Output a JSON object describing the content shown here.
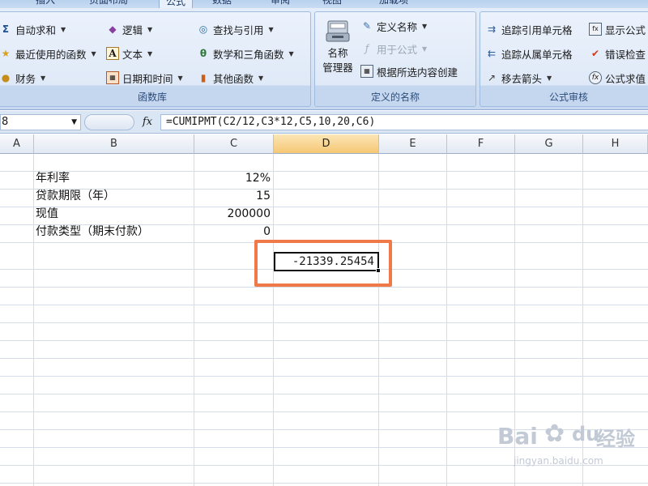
{
  "tabs": [
    "插入",
    "页面布局",
    "公式",
    "数据",
    "审阅",
    "视图",
    "加载项"
  ],
  "active_tab_index": 2,
  "ribbon": {
    "function_library": {
      "label": "函数库",
      "items": [
        {
          "label": "自动求和",
          "icon": "sigma-icon",
          "caret": true
        },
        {
          "label": "最近使用的函数",
          "icon": "star-icon",
          "caret": true
        },
        {
          "label": "财务",
          "icon": "coins-icon",
          "caret": true
        },
        {
          "label": "逻辑",
          "icon": "logic-icon",
          "caret": true
        },
        {
          "label": "文本",
          "icon": "text-icon",
          "caret": true
        },
        {
          "label": "日期和时间",
          "icon": "calendar-icon",
          "caret": true
        },
        {
          "label": "查找与引用",
          "icon": "lookup-icon",
          "caret": true
        },
        {
          "label": "数学和三角函数",
          "icon": "math-icon",
          "caret": true
        },
        {
          "label": "其他函数",
          "icon": "more-functions-icon",
          "caret": true
        }
      ]
    },
    "defined_names": {
      "label": "定义的名称",
      "name_manager": "名称\n管理器",
      "items": [
        {
          "label": "定义名称",
          "icon": "define-name-icon",
          "caret": true,
          "disabled": false
        },
        {
          "label": "用于公式",
          "icon": "use-in-formula-icon",
          "caret": true,
          "disabled": true
        },
        {
          "label": "根据所选内容创建",
          "icon": "create-from-selection-icon",
          "caret": false,
          "disabled": false
        }
      ]
    },
    "formula_auditing": {
      "label": "公式审核",
      "items": [
        {
          "label": "追踪引用单元格",
          "icon": "trace-precedents-icon"
        },
        {
          "label": "追踪从属单元格",
          "icon": "trace-dependents-icon"
        },
        {
          "label": "移去箭头",
          "icon": "remove-arrows-icon",
          "caret": true
        },
        {
          "label": "显示公式",
          "icon": "show-formulas-icon"
        },
        {
          "label": "错误检查",
          "icon": "error-checking-icon",
          "caret": true
        },
        {
          "label": "公式求值",
          "icon": "evaluate-formula-icon"
        }
      ]
    }
  },
  "formula_bar": {
    "name_box": "8",
    "fx_label": "fx",
    "formula": "=CUMIPMT(C2/12,C3*12,C5,10,20,C6)"
  },
  "columns": [
    "A",
    "B",
    "C",
    "D",
    "E",
    "F",
    "G",
    "H"
  ],
  "selected_column": "D",
  "rows": [
    {
      "label": "年利率",
      "value": "12%"
    },
    {
      "label": "贷款期限（年）",
      "value": "15"
    },
    {
      "label": "现值",
      "value": "200000"
    },
    {
      "label": "付款类型（期末付款）",
      "value": "0"
    }
  ],
  "result_cell": "-21339.25454",
  "colors": {
    "highlight_box": "#f0794a",
    "selected_header": "#f6c774",
    "ribbon_bg": "#dfe9f7"
  },
  "watermark": {
    "brand": "Bai",
    "brand2": "du",
    "brand_cn": "经验",
    "url": "jingyan.baidu.com"
  }
}
